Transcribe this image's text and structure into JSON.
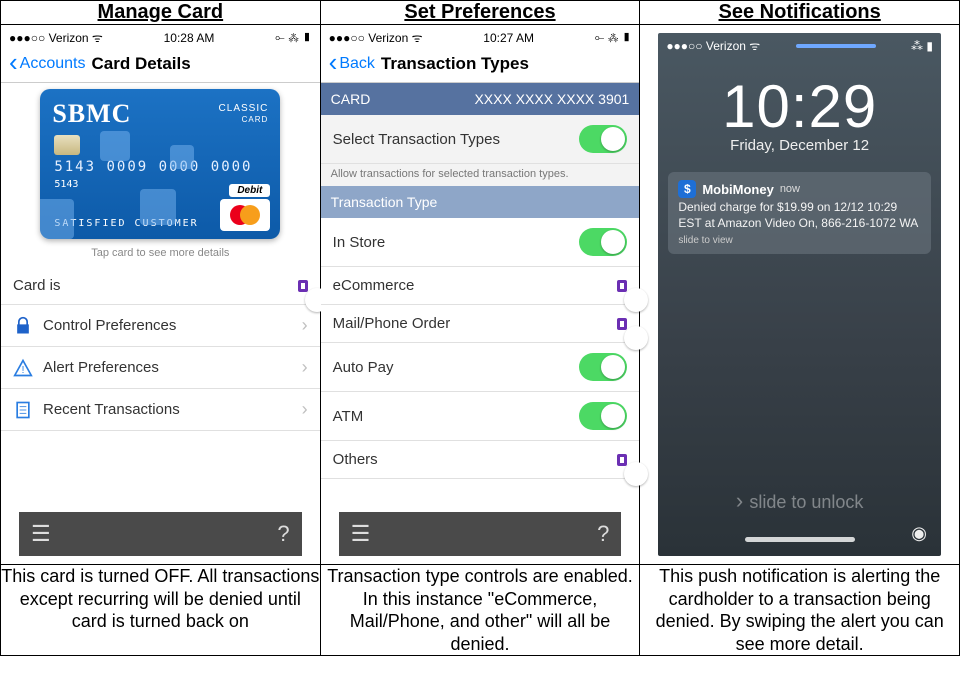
{
  "headers": {
    "col1": "Manage Card",
    "col2": "Set Preferences",
    "col3": "See Notifications"
  },
  "captions": {
    "col1": "This card is turned OFF. All transactions except recurring will be denied until card is turned back on",
    "col2": "Transaction type controls are enabled. In this instance \"eCommerce, Mail/Phone, and other\" will all be denied.",
    "col3": "This push notification is alerting the cardholder to a transaction being denied. By swiping the alert you can see more detail."
  },
  "screen1": {
    "status": {
      "carrier": "●●●○○ Verizon ᯤ",
      "time": "10:28 AM",
      "right": "⟜ ⁂ ▮"
    },
    "back_label": "Accounts",
    "title": "Card Details",
    "card": {
      "brand": "SBMC",
      "variant_line1": "CLASSIC",
      "variant_line2": "CARD",
      "number": "5143 0009 0000 0000",
      "number_small": "5143",
      "holder": "SATISFIED  CUSTOMER",
      "debit": "Debit",
      "network": "MasterCard"
    },
    "tap_hint": "Tap card to see more details",
    "rows": {
      "card_is": "Card is",
      "control": "Control Preferences",
      "alert": "Alert Preferences",
      "recent": "Recent Transactions"
    }
  },
  "screen2": {
    "status": {
      "carrier": "●●●○○ Verizon ᯤ",
      "time": "10:27 AM",
      "right": "⟜ ⁂ ▮"
    },
    "back_label": "Back",
    "title": "Transaction Types",
    "card_band_label": "CARD",
    "card_band_value": "XXXX XXXX XXXX 3901",
    "select_row": "Select Transaction Types",
    "select_sub": "Allow transactions for selected transaction types.",
    "type_band": "Transaction Type",
    "types": {
      "in_store": "In Store",
      "ecommerce": "eCommerce",
      "mail_phone": "Mail/Phone Order",
      "auto_pay": "Auto Pay",
      "atm": "ATM",
      "others": "Others"
    }
  },
  "screen3": {
    "status": {
      "carrier": "●●●○○ Verizon ᯤ",
      "right": "⁂ ▮"
    },
    "time": "10:29",
    "date": "Friday, December 12",
    "notif": {
      "app": "MobiMoney",
      "now": "now",
      "body": "Denied charge for $19.99 on 12/12 10:29 EST at Amazon Video On, 866-216-1072 WA",
      "slide": "slide to view"
    },
    "unlock": "slide to unlock"
  }
}
